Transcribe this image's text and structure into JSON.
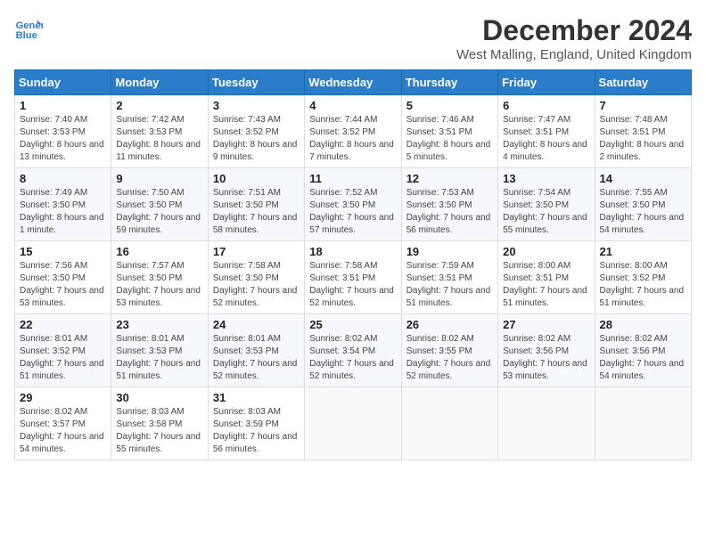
{
  "header": {
    "logo_line1": "General",
    "logo_line2": "Blue",
    "month_title": "December 2024",
    "location": "West Malling, England, United Kingdom"
  },
  "days_of_week": [
    "Sunday",
    "Monday",
    "Tuesday",
    "Wednesday",
    "Thursday",
    "Friday",
    "Saturday"
  ],
  "weeks": [
    [
      {
        "day": "1",
        "sunrise": "7:40 AM",
        "sunset": "3:53 PM",
        "daylight": "8 hours and 13 minutes."
      },
      {
        "day": "2",
        "sunrise": "7:42 AM",
        "sunset": "3:53 PM",
        "daylight": "8 hours and 11 minutes."
      },
      {
        "day": "3",
        "sunrise": "7:43 AM",
        "sunset": "3:52 PM",
        "daylight": "8 hours and 9 minutes."
      },
      {
        "day": "4",
        "sunrise": "7:44 AM",
        "sunset": "3:52 PM",
        "daylight": "8 hours and 7 minutes."
      },
      {
        "day": "5",
        "sunrise": "7:46 AM",
        "sunset": "3:51 PM",
        "daylight": "8 hours and 5 minutes."
      },
      {
        "day": "6",
        "sunrise": "7:47 AM",
        "sunset": "3:51 PM",
        "daylight": "8 hours and 4 minutes."
      },
      {
        "day": "7",
        "sunrise": "7:48 AM",
        "sunset": "3:51 PM",
        "daylight": "8 hours and 2 minutes."
      }
    ],
    [
      {
        "day": "8",
        "sunrise": "7:49 AM",
        "sunset": "3:50 PM",
        "daylight": "8 hours and 1 minute."
      },
      {
        "day": "9",
        "sunrise": "7:50 AM",
        "sunset": "3:50 PM",
        "daylight": "7 hours and 59 minutes."
      },
      {
        "day": "10",
        "sunrise": "7:51 AM",
        "sunset": "3:50 PM",
        "daylight": "7 hours and 58 minutes."
      },
      {
        "day": "11",
        "sunrise": "7:52 AM",
        "sunset": "3:50 PM",
        "daylight": "7 hours and 57 minutes."
      },
      {
        "day": "12",
        "sunrise": "7:53 AM",
        "sunset": "3:50 PM",
        "daylight": "7 hours and 56 minutes."
      },
      {
        "day": "13",
        "sunrise": "7:54 AM",
        "sunset": "3:50 PM",
        "daylight": "7 hours and 55 minutes."
      },
      {
        "day": "14",
        "sunrise": "7:55 AM",
        "sunset": "3:50 PM",
        "daylight": "7 hours and 54 minutes."
      }
    ],
    [
      {
        "day": "15",
        "sunrise": "7:56 AM",
        "sunset": "3:50 PM",
        "daylight": "7 hours and 53 minutes."
      },
      {
        "day": "16",
        "sunrise": "7:57 AM",
        "sunset": "3:50 PM",
        "daylight": "7 hours and 53 minutes."
      },
      {
        "day": "17",
        "sunrise": "7:58 AM",
        "sunset": "3:50 PM",
        "daylight": "7 hours and 52 minutes."
      },
      {
        "day": "18",
        "sunrise": "7:58 AM",
        "sunset": "3:51 PM",
        "daylight": "7 hours and 52 minutes."
      },
      {
        "day": "19",
        "sunrise": "7:59 AM",
        "sunset": "3:51 PM",
        "daylight": "7 hours and 51 minutes."
      },
      {
        "day": "20",
        "sunrise": "8:00 AM",
        "sunset": "3:51 PM",
        "daylight": "7 hours and 51 minutes."
      },
      {
        "day": "21",
        "sunrise": "8:00 AM",
        "sunset": "3:52 PM",
        "daylight": "7 hours and 51 minutes."
      }
    ],
    [
      {
        "day": "22",
        "sunrise": "8:01 AM",
        "sunset": "3:52 PM",
        "daylight": "7 hours and 51 minutes."
      },
      {
        "day": "23",
        "sunrise": "8:01 AM",
        "sunset": "3:53 PM",
        "daylight": "7 hours and 51 minutes."
      },
      {
        "day": "24",
        "sunrise": "8:01 AM",
        "sunset": "3:53 PM",
        "daylight": "7 hours and 52 minutes."
      },
      {
        "day": "25",
        "sunrise": "8:02 AM",
        "sunset": "3:54 PM",
        "daylight": "7 hours and 52 minutes."
      },
      {
        "day": "26",
        "sunrise": "8:02 AM",
        "sunset": "3:55 PM",
        "daylight": "7 hours and 52 minutes."
      },
      {
        "day": "27",
        "sunrise": "8:02 AM",
        "sunset": "3:56 PM",
        "daylight": "7 hours and 53 minutes."
      },
      {
        "day": "28",
        "sunrise": "8:02 AM",
        "sunset": "3:56 PM",
        "daylight": "7 hours and 54 minutes."
      }
    ],
    [
      {
        "day": "29",
        "sunrise": "8:02 AM",
        "sunset": "3:57 PM",
        "daylight": "7 hours and 54 minutes."
      },
      {
        "day": "30",
        "sunrise": "8:03 AM",
        "sunset": "3:58 PM",
        "daylight": "7 hours and 55 minutes."
      },
      {
        "day": "31",
        "sunrise": "8:03 AM",
        "sunset": "3:59 PM",
        "daylight": "7 hours and 56 minutes."
      },
      null,
      null,
      null,
      null
    ]
  ]
}
